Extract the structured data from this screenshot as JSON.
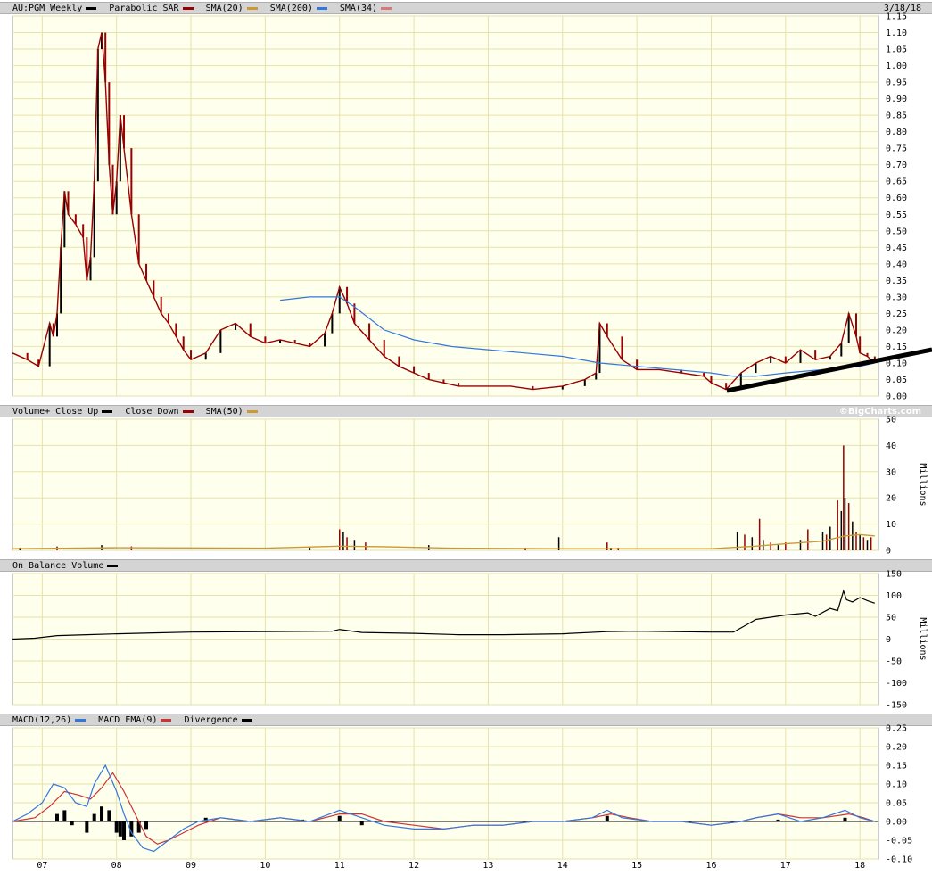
{
  "panels": {
    "price": {
      "header": [
        {
          "label": "AU:PGM Weekly",
          "color": "#000000"
        },
        {
          "label": "Parabolic SAR",
          "color": "#990000"
        },
        {
          "label": "SMA(20)",
          "color": "#cc9933"
        },
        {
          "label": "SMA(200)",
          "color": "#3377dd"
        },
        {
          "label": "SMA(34)",
          "color": "#dd7777"
        }
      ],
      "date": "3/18/18"
    },
    "volume": {
      "header": [
        {
          "label": "Volume+ Close Up",
          "color": "#000000"
        },
        {
          "label": "Close Down",
          "color": "#990000"
        },
        {
          "label": "SMA(50)",
          "color": "#cc9933"
        }
      ],
      "credit": "©BigCharts.com"
    },
    "obv": {
      "header": [
        {
          "label": "On Balance Volume",
          "color": "#000000"
        }
      ]
    },
    "macd": {
      "header": [
        {
          "label": "MACD(12,26)",
          "color": "#3377dd"
        },
        {
          "label": "MACD EMA(9)",
          "color": "#cc3333"
        },
        {
          "label": "Divergence",
          "color": "#000000"
        }
      ]
    }
  },
  "colors": {
    "plot_bg": "#ffffee",
    "grid": "#e6e2a8",
    "bar_up": "#000000",
    "bar_down": "#990000",
    "sar": "#990000",
    "sma20": "#cc9933",
    "sma200": "#3377dd",
    "sma34": "#dd7777",
    "trendline": "#000000",
    "obv": "#000000",
    "macd": "#3377dd",
    "macd_ema": "#cc3333",
    "divergence": "#000000"
  },
  "chart_data": [
    {
      "type": "line",
      "title": "AU:PGM Weekly",
      "ylabel": "",
      "ylim": [
        0,
        1.15
      ],
      "yticks": [
        0,
        0.05,
        0.1,
        0.15,
        0.2,
        0.25,
        0.3,
        0.35,
        0.4,
        0.45,
        0.5,
        0.55,
        0.6,
        0.65,
        0.7,
        0.75,
        0.8,
        0.85,
        0.9,
        0.95,
        1.0,
        1.05,
        1.1,
        1.15
      ],
      "ytick_labels": [
        "0.00",
        "0.05",
        "0.10",
        "0.15",
        "0.20",
        "0.25",
        "0.30",
        "0.35",
        "0.40",
        "0.45",
        "0.50",
        "0.55",
        "0.60",
        "0.65",
        "0.70",
        "0.75",
        "0.80",
        "0.85",
        "0.90",
        "0.95",
        "1.00",
        "1.05",
        "1.10",
        "1.15"
      ],
      "x_domain": [
        2006.6,
        2018.25
      ],
      "x_ticks": [
        2007,
        2008,
        2009,
        2010,
        2011,
        2012,
        2013,
        2014,
        2015,
        2016,
        2017,
        2018
      ],
      "x_tick_labels": [
        "07",
        "08",
        "09",
        "10",
        "11",
        "12",
        "13",
        "14",
        "15",
        "16",
        "17",
        "18"
      ],
      "grid": true,
      "series": [
        {
          "name": "AU:PGM Weekly",
          "x": [
            2006.6,
            2006.8,
            2006.95,
            2007.1,
            2007.15,
            2007.2,
            2007.25,
            2007.3,
            2007.35,
            2007.45,
            2007.55,
            2007.6,
            2007.65,
            2007.7,
            2007.75,
            2007.8,
            2007.85,
            2007.9,
            2007.95,
            2008.0,
            2008.05,
            2008.1,
            2008.2,
            2008.3,
            2008.4,
            2008.5,
            2008.6,
            2008.7,
            2008.8,
            2008.9,
            2009.0,
            2009.2,
            2009.4,
            2009.6,
            2009.8,
            2010.0,
            2010.2,
            2010.4,
            2010.6,
            2010.8,
            2010.9,
            2011.0,
            2011.1,
            2011.2,
            2011.4,
            2011.6,
            2011.8,
            2012.0,
            2012.2,
            2012.4,
            2012.6,
            2012.8,
            2013.0,
            2013.3,
            2013.6,
            2014.0,
            2014.3,
            2014.45,
            2014.5,
            2014.6,
            2014.8,
            2015.0,
            2015.3,
            2015.6,
            2015.9,
            2016.0,
            2016.2,
            2016.4,
            2016.6,
            2016.8,
            2017.0,
            2017.2,
            2017.4,
            2017.6,
            2017.75,
            2017.85,
            2017.95,
            2018.0,
            2018.1,
            2018.2
          ],
          "values": [
            0.13,
            0.11,
            0.09,
            0.22,
            0.18,
            0.25,
            0.45,
            0.62,
            0.55,
            0.52,
            0.48,
            0.35,
            0.42,
            0.65,
            1.05,
            1.1,
            0.95,
            0.7,
            0.55,
            0.65,
            0.85,
            0.75,
            0.55,
            0.4,
            0.35,
            0.3,
            0.25,
            0.22,
            0.18,
            0.14,
            0.11,
            0.13,
            0.2,
            0.22,
            0.18,
            0.16,
            0.17,
            0.16,
            0.15,
            0.19,
            0.25,
            0.33,
            0.28,
            0.22,
            0.17,
            0.12,
            0.09,
            0.07,
            0.05,
            0.04,
            0.03,
            0.03,
            0.03,
            0.03,
            0.02,
            0.03,
            0.05,
            0.07,
            0.22,
            0.18,
            0.11,
            0.08,
            0.08,
            0.07,
            0.06,
            0.04,
            0.02,
            0.07,
            0.1,
            0.12,
            0.1,
            0.14,
            0.11,
            0.12,
            0.16,
            0.25,
            0.18,
            0.13,
            0.12,
            0.1
          ]
        },
        {
          "name": "SMA(200)",
          "x": [
            2010.2,
            2010.6,
            2011.0,
            2011.2,
            2011.6,
            2012.0,
            2012.5,
            2013.0,
            2013.5,
            2014.0,
            2014.5,
            2015.0,
            2015.5,
            2016.0,
            2016.3,
            2016.6,
            2017.0,
            2017.5,
            2018.0,
            2018.2
          ],
          "values": [
            0.29,
            0.3,
            0.3,
            0.27,
            0.2,
            0.17,
            0.15,
            0.14,
            0.13,
            0.12,
            0.1,
            0.09,
            0.08,
            0.07,
            0.06,
            0.06,
            0.07,
            0.08,
            0.09,
            0.1
          ]
        }
      ]
    },
    {
      "type": "bar",
      "title": "Volume",
      "ylabel": "Millions",
      "ylim": [
        0,
        50
      ],
      "yticks": [
        0,
        10,
        20,
        30,
        40,
        50
      ],
      "ytick_labels": [
        "0",
        "10",
        "20",
        "30",
        "40",
        "50"
      ],
      "x_ticks": [
        2007,
        2008,
        2009,
        2010,
        2011,
        2012,
        2013,
        2014,
        2015,
        2016,
        2017,
        2018
      ],
      "x": [
        2006.7,
        2007.2,
        2007.8,
        2008.2,
        2010.6,
        2011.0,
        2011.05,
        2011.1,
        2011.2,
        2011.35,
        2012.2,
        2013.5,
        2013.95,
        2014.6,
        2014.65,
        2014.75,
        2016.35,
        2016.45,
        2016.55,
        2016.65,
        2016.7,
        2016.8,
        2016.9,
        2017.0,
        2017.2,
        2017.3,
        2017.5,
        2017.55,
        2017.6,
        2017.7,
        2017.75,
        2017.78,
        2017.8,
        2017.85,
        2017.9,
        2017.95,
        2018.0,
        2018.05,
        2018.1,
        2018.15
      ],
      "values": [
        1,
        1.5,
        2,
        1.5,
        1,
        8,
        7,
        5,
        4,
        3,
        2,
        1,
        5,
        3,
        1,
        1,
        7,
        6,
        5,
        12,
        4,
        3,
        2,
        3,
        4,
        8,
        7,
        6,
        9,
        19,
        15,
        40,
        20,
        18,
        11,
        7,
        6,
        5,
        4,
        5
      ],
      "sma50": {
        "x": [
          2006.6,
          2008.0,
          2010.0,
          2011.0,
          2011.6,
          2012.5,
          2014.0,
          2016.0,
          2016.6,
          2017.0,
          2017.5,
          2017.8,
          2018.0,
          2018.2
        ],
        "values": [
          0.6,
          1.0,
          0.8,
          1.6,
          1.4,
          0.8,
          0.6,
          0.6,
          1.6,
          2.5,
          3.5,
          5.5,
          6,
          5.5
        ]
      },
      "grid": true
    },
    {
      "type": "line",
      "title": "On Balance Volume",
      "ylabel": "Millions",
      "ylim": [
        -150,
        150
      ],
      "yticks": [
        -150,
        -100,
        -50,
        0,
        50,
        100,
        150
      ],
      "ytick_labels": [
        "-150",
        "-100",
        "-50",
        "0",
        "50",
        "100",
        "150"
      ],
      "x_ticks": [
        2007,
        2008,
        2009,
        2010,
        2011,
        2012,
        2013,
        2014,
        2015,
        2016,
        2017,
        2018
      ],
      "x": [
        2006.6,
        2006.9,
        2007.2,
        2007.6,
        2008.0,
        2008.5,
        2009.0,
        2010.0,
        2010.9,
        2011.0,
        2011.3,
        2012.0,
        2012.6,
        2013.2,
        2014.0,
        2014.6,
        2015.0,
        2016.0,
        2016.3,
        2016.5,
        2016.6,
        2016.8,
        2017.0,
        2017.3,
        2017.4,
        2017.6,
        2017.7,
        2017.78,
        2017.82,
        2017.9,
        2018.0,
        2018.1,
        2018.2
      ],
      "values": [
        0,
        2,
        8,
        10,
        12,
        14,
        16,
        17,
        18,
        22,
        15,
        13,
        10,
        10,
        12,
        17,
        18,
        16,
        16,
        35,
        45,
        50,
        55,
        60,
        52,
        70,
        65,
        110,
        90,
        85,
        95,
        88,
        82
      ],
      "grid": true
    },
    {
      "type": "line",
      "title": "MACD(12,26)",
      "ylim": [
        -0.1,
        0.25
      ],
      "yticks": [
        -0.1,
        -0.05,
        0.0,
        0.05,
        0.1,
        0.15,
        0.2,
        0.25
      ],
      "ytick_labels": [
        "-0.10",
        "-0.05",
        "0.00",
        "0.05",
        "0.10",
        "0.15",
        "0.20",
        "0.25"
      ],
      "x_ticks": [
        2007,
        2008,
        2009,
        2010,
        2011,
        2012,
        2013,
        2014,
        2015,
        2016,
        2017,
        2018
      ],
      "x_tick_labels": [
        "07",
        "08",
        "09",
        "10",
        "11",
        "12",
        "13",
        "14",
        "15",
        "16",
        "17",
        "18"
      ],
      "series": [
        {
          "name": "MACD(12,26)",
          "x": [
            2006.6,
            2006.8,
            2007.0,
            2007.15,
            2007.3,
            2007.45,
            2007.6,
            2007.7,
            2007.85,
            2008.0,
            2008.1,
            2008.2,
            2008.35,
            2008.5,
            2008.7,
            2008.9,
            2009.1,
            2009.4,
            2009.8,
            2010.2,
            2010.6,
            2011.0,
            2011.3,
            2011.6,
            2012.0,
            2012.4,
            2012.8,
            2013.2,
            2013.6,
            2014.0,
            2014.4,
            2014.6,
            2014.8,
            2015.2,
            2015.6,
            2016.0,
            2016.4,
            2016.6,
            2016.9,
            2017.2,
            2017.5,
            2017.8,
            2018.0,
            2018.2
          ],
          "values": [
            0,
            0.02,
            0.05,
            0.1,
            0.09,
            0.05,
            0.04,
            0.1,
            0.15,
            0.08,
            0.02,
            -0.03,
            -0.07,
            -0.08,
            -0.05,
            -0.02,
            0.0,
            0.01,
            0.0,
            0.01,
            0.0,
            0.03,
            0.01,
            -0.01,
            -0.02,
            -0.02,
            -0.01,
            -0.01,
            0.0,
            0.0,
            0.01,
            0.03,
            0.01,
            0.0,
            0.0,
            -0.01,
            0.0,
            0.01,
            0.02,
            0.0,
            0.01,
            0.03,
            0.01,
            0.0
          ]
        },
        {
          "name": "MACD EMA(9)",
          "x": [
            2006.6,
            2006.9,
            2007.1,
            2007.3,
            2007.5,
            2007.65,
            2007.8,
            2007.95,
            2008.1,
            2008.25,
            2008.4,
            2008.55,
            2008.7,
            2008.9,
            2009.1,
            2009.4,
            2009.8,
            2010.2,
            2010.6,
            2011.0,
            2011.3,
            2011.6,
            2012.0,
            2012.4,
            2012.8,
            2013.2,
            2013.6,
            2014.0,
            2014.4,
            2014.65,
            2014.9,
            2015.2,
            2015.6,
            2016.0,
            2016.4,
            2016.6,
            2016.9,
            2017.2,
            2017.5,
            2017.85,
            2018.05,
            2018.2
          ],
          "values": [
            0,
            0.01,
            0.04,
            0.08,
            0.07,
            0.06,
            0.09,
            0.13,
            0.08,
            0.02,
            -0.04,
            -0.06,
            -0.05,
            -0.03,
            -0.01,
            0.01,
            0.0,
            0.01,
            0.0,
            0.02,
            0.02,
            0.0,
            -0.01,
            -0.02,
            -0.01,
            -0.01,
            0.0,
            0.0,
            0.01,
            0.02,
            0.01,
            0.0,
            0.0,
            -0.01,
            0.0,
            0.01,
            0.02,
            0.01,
            0.01,
            0.02,
            0.01,
            0.0
          ]
        }
      ],
      "divergence": {
        "x": [
          2007.2,
          2007.3,
          2007.4,
          2007.6,
          2007.7,
          2007.8,
          2007.9,
          2008.0,
          2008.05,
          2008.1,
          2008.2,
          2008.3,
          2008.4,
          2009.2,
          2010.5,
          2011.0,
          2011.3,
          2014.6,
          2016.9,
          2017.8
        ],
        "values": [
          0.02,
          0.03,
          -0.01,
          -0.03,
          0.02,
          0.04,
          0.03,
          -0.03,
          -0.04,
          -0.05,
          -0.04,
          -0.03,
          -0.02,
          0.01,
          0.005,
          0.015,
          -0.01,
          0.015,
          0.005,
          0.01
        ]
      },
      "grid": true
    }
  ]
}
